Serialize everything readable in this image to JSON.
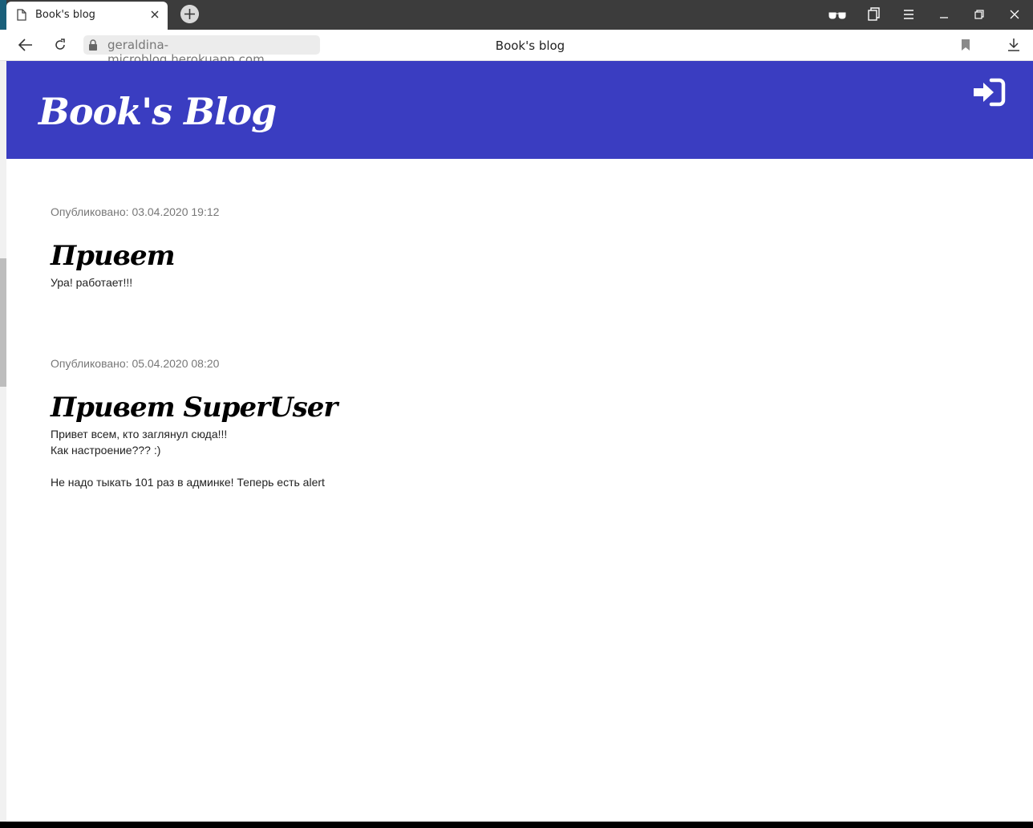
{
  "browser": {
    "tab": {
      "title": "Book's blog"
    },
    "address": {
      "url": "geraldina-microblog.herokuapp.com"
    },
    "page_title": "Book's blog",
    "icons": [
      "document-icon",
      "close-icon",
      "plus-icon",
      "reader-mode-icon",
      "collections-icon",
      "menu-icon",
      "minimize-icon",
      "restore-icon",
      "window-close-icon",
      "back-arrow-icon",
      "reload-icon",
      "lock-icon",
      "bookmark-icon",
      "download-icon"
    ]
  },
  "site": {
    "brand": "Book's Blog",
    "login_icon": "sign-in-icon",
    "colors": {
      "header": "#3a3dc1"
    }
  },
  "posts": [
    {
      "meta": "Опубликовано: 03.04.2020 19:12",
      "title": "Привет",
      "body": "Ура! работает!!!"
    },
    {
      "meta": "Опубликовано: 05.04.2020 08:20",
      "title": "Привет SuperUser",
      "body": "Привет всем, кто заглянул сюда!!!\nКак настроение??? :)\n\nНе надо тыкать 101 раз в админке! Теперь есть alert"
    }
  ]
}
